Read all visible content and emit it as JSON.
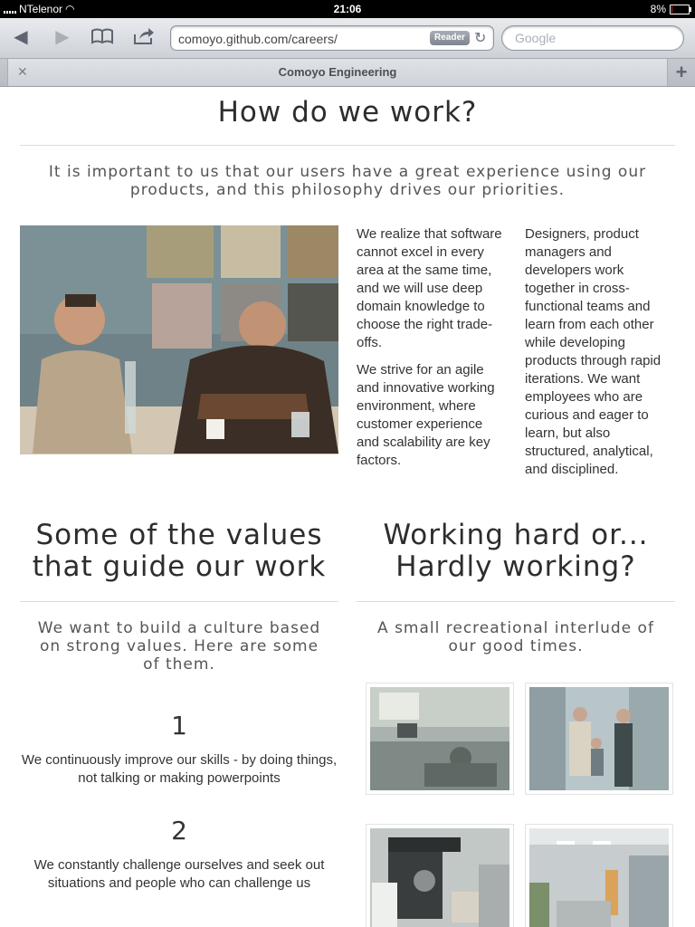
{
  "status": {
    "carrier": "NTelenor",
    "time": "21:06",
    "battery": "8%",
    "battery_level": 0.08
  },
  "toolbar": {
    "url": "comoyo.github.com/careers/",
    "reader": "Reader",
    "search_placeholder": "Google"
  },
  "tab": {
    "title": "Comoyo Engineering"
  },
  "work": {
    "heading": "How do we work?",
    "intro": "It is important to us that our users have a great experience using our products, and this philosophy drives our priorities.",
    "col1": [
      "We realize that software cannot excel in every area at the same time, and we will use deep domain knowledge to choose the right trade-offs.",
      "We strive for an agile and innovative working environment, where customer experience and scalability are key factors."
    ],
    "col2": "Designers, product managers and developers work together in cross-functional teams and learn from each other while developing products through rapid iterations. We want employees who are curious and eager to learn, but also structured, analytical, and disciplined."
  },
  "values": {
    "heading": "Some of the values that guide our work",
    "intro": "We want to build a culture based on strong values. Here are some of them.",
    "items": [
      {
        "num": "1",
        "text": "We continuously improve our skills - by doing things, not talking or making powerpoints"
      },
      {
        "num": "2",
        "text": "We constantly challenge ourselves and seek out situations and people who can challenge us"
      }
    ]
  },
  "fun": {
    "heading": "Working hard or... Hardly working?",
    "intro": "A small recreational interlude of our good times."
  }
}
